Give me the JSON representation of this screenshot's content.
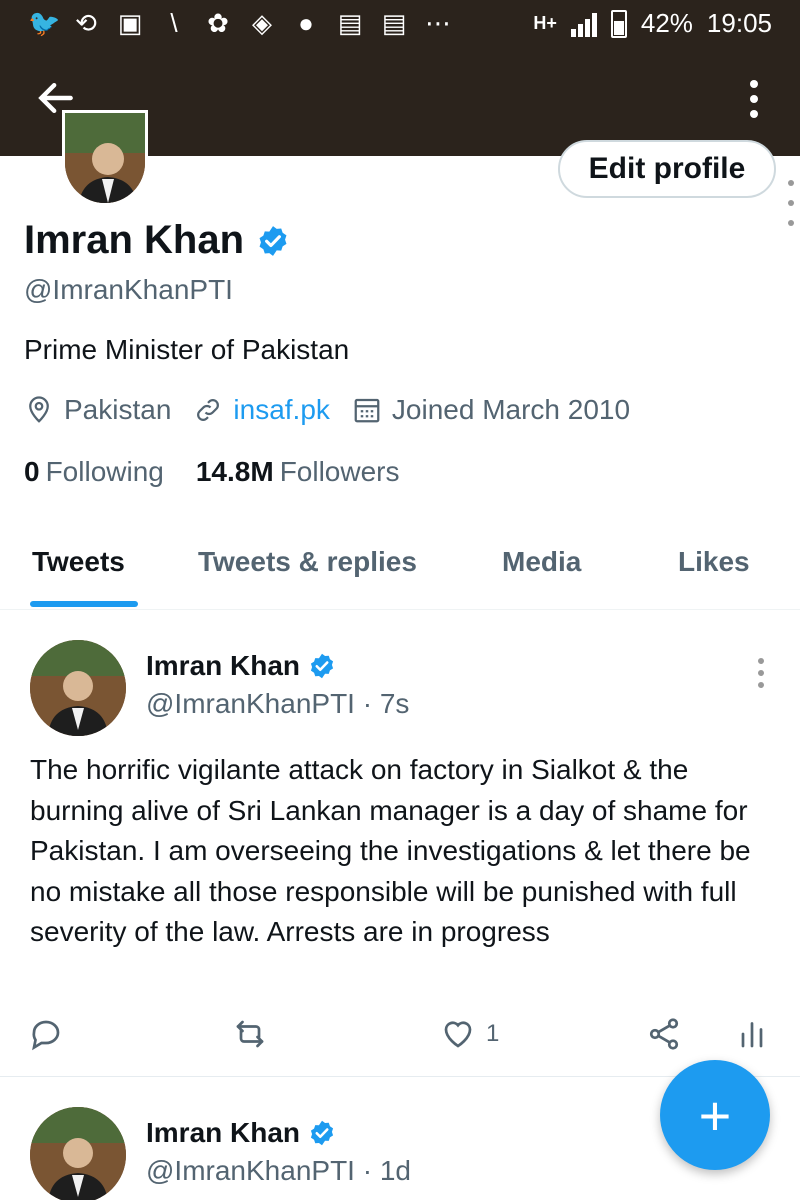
{
  "status_bar": {
    "icons": [
      "twitter-icon",
      "sync-icon",
      "gallery-icon",
      "antenna-icon",
      "bike-icon",
      "blackberry-icon",
      "bomb-icon",
      "calendar-icon",
      "calendar-icon",
      "more-icon"
    ],
    "network": "H+",
    "battery": "42%",
    "time": "19:05"
  },
  "app_bar": {
    "back_icon": "arrow-left-icon",
    "more_icon": "more-vertical-icon"
  },
  "profile": {
    "edit_button": "Edit profile",
    "name": "Imran Khan",
    "handle": "@ImranKhanPTI",
    "bio": "Prime Minister of Pakistan",
    "location": "Pakistan",
    "website": "insaf.pk",
    "joined": "Joined March 2010",
    "following_count": "0",
    "following_label": "Following",
    "followers_count": "14.8M",
    "followers_label": "Followers"
  },
  "tabs": [
    "Tweets",
    "Tweets & replies",
    "Media",
    "Likes"
  ],
  "tweets": [
    {
      "name": "Imran Khan",
      "handle_time": "@ImranKhanPTI · 7s",
      "text": "The horrific vigilante attack on factory in Sialkot & the burning alive of Sri Lankan manager is a day of shame for Pakistan. I am overseeing the investigations & let there be no mistake all those responsible will be punished with full severity of the law. Arrests are in progress",
      "likes": "1"
    },
    {
      "name": "Imran Khan",
      "handle_time": "@ImranKhanPTI · 1d"
    }
  ],
  "fab_label": "+",
  "colors": {
    "accent": "#1d9bf0",
    "header": "#2b231c",
    "text_secondary": "#536471"
  }
}
